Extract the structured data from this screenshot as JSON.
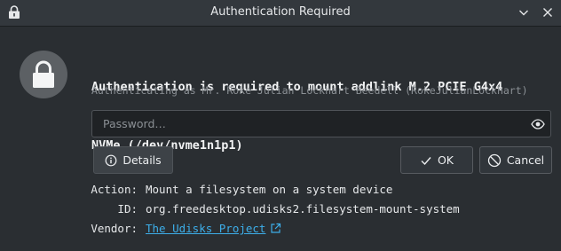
{
  "window": {
    "title": "Authentication Required"
  },
  "dialog": {
    "heading_line1": "Authentication is required to mount addlink M.2 PCIE G4x4",
    "heading_line2": "NVMe (/dev/nvme1n1p1)",
    "subtext": "Authenticating as Mr. Roke Julian Lockhart Beedell (RokeJulianLockhart)",
    "password_placeholder": "Password…",
    "password_value": ""
  },
  "buttons": {
    "details": "Details",
    "ok": "OK",
    "cancel": "Cancel"
  },
  "details": {
    "action_label": "Action:",
    "action_value": "Mount a filesystem on a system device",
    "id_label": "ID:",
    "id_value": "org.freedesktop.udisks2.filesystem-mount-system",
    "vendor_label": "Vendor:",
    "vendor_value": "The Udisks Project"
  },
  "icons": {
    "app": "lock-app-icon",
    "minimize": "chevron-down-icon",
    "close": "close-icon",
    "lock": "padlock-icon",
    "reveal": "eye-icon",
    "details": "info-icon",
    "ok": "checkmark-icon",
    "cancel": "cancel-icon",
    "external": "external-link-icon"
  },
  "colors": {
    "background": "#2a2e32",
    "titlebar": "#33383d",
    "link": "#3daee9",
    "muted_text": "#8b9095"
  }
}
